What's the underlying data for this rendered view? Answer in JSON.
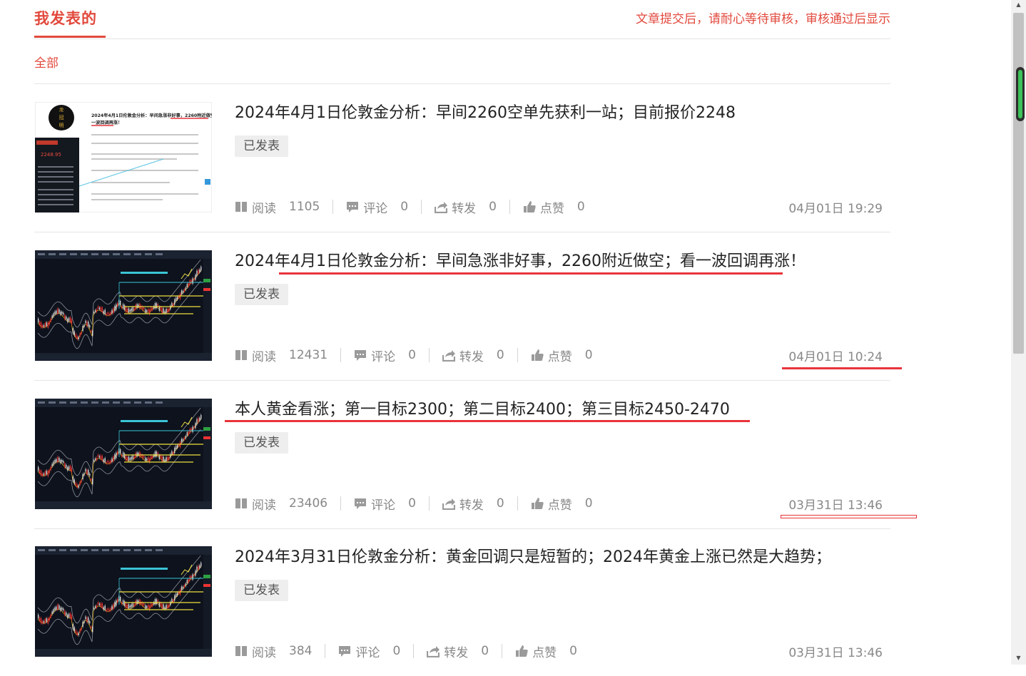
{
  "header": {
    "title": "我发表的",
    "notice": "文章提交后，请耐心等待审核，审核通过后显示"
  },
  "filter": {
    "all_label": "全部"
  },
  "stats_labels": {
    "read": "阅读",
    "comment": "评论",
    "share": "转发",
    "like": "点赞"
  },
  "colors": {
    "accent": "#e2493d",
    "annotation": "#e8343a",
    "muted": "#888888"
  },
  "icons": {
    "read": "book-icon",
    "comment": "comment-icon",
    "share": "share-icon",
    "like": "thumbs-up-icon"
  },
  "articles": [
    {
      "title": "2024年4月1日伦敦金分析：早间2260空单先获利一站；目前报价2248",
      "status": "已发表",
      "reads": "1105",
      "comments": "0",
      "shares": "0",
      "likes": "0",
      "date": "04月01日 19:29",
      "thumbnail": {
        "heading_line1": "2024年4月1日伦敦金分析：早间急涨非好事，2260附近做空；看",
        "heading_line2": "一波回调再涨！",
        "price": "2248.95",
        "seal": "龙 冠 明"
      }
    },
    {
      "title": "2024年4月1日伦敦金分析：早间急涨非好事，2260附近做空；看一波回调再涨！",
      "status": "已发表",
      "reads": "12431",
      "comments": "0",
      "shares": "0",
      "likes": "0",
      "date": "04月01日 10:24"
    },
    {
      "title": "本人黄金看涨；第一目标2300；第二目标2400；第三目标2450-2470",
      "status": "已发表",
      "reads": "23406",
      "comments": "0",
      "shares": "0",
      "likes": "0",
      "date": "03月31日 13:46"
    },
    {
      "title": "2024年3月31日伦敦金分析：黄金回调只是短暂的；2024年黄金上涨已然是大趋势；",
      "status": "已发表",
      "reads": "384",
      "comments": "0",
      "shares": "0",
      "likes": "0",
      "date": "03月31日 13:46"
    }
  ]
}
